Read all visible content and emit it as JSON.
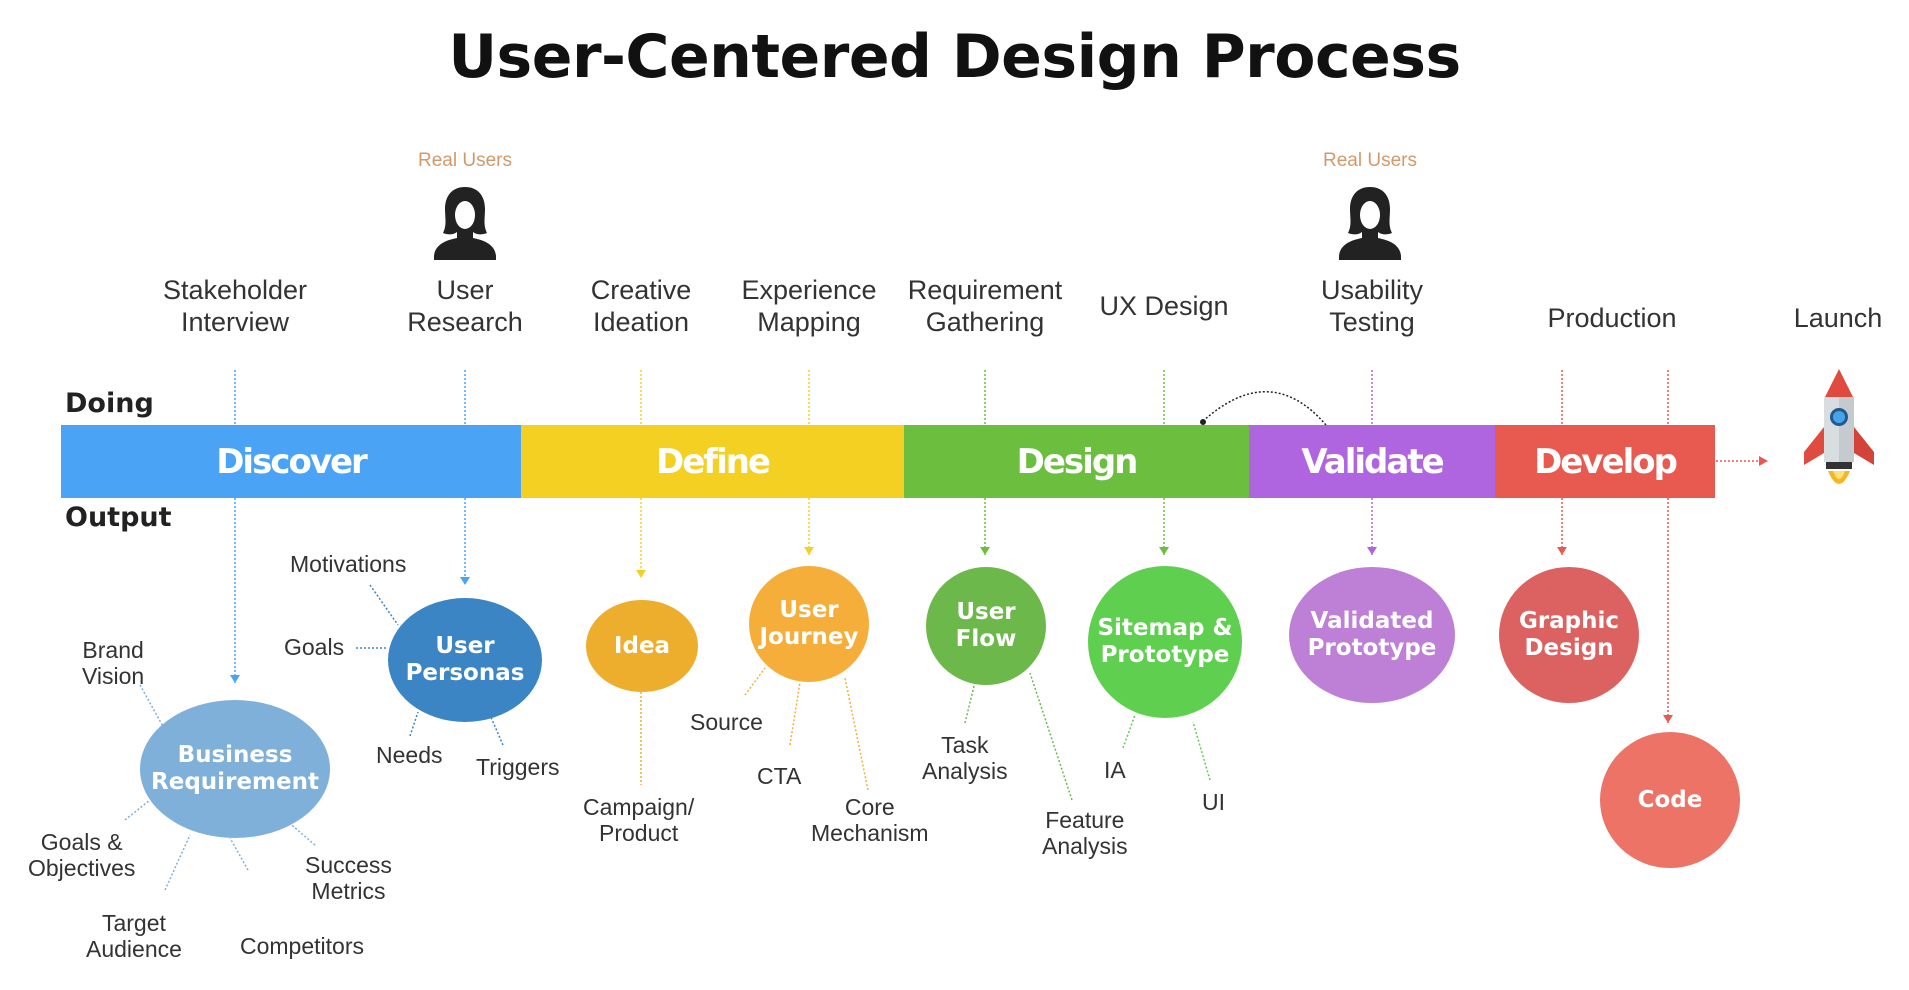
{
  "title": "User-Centered Design Process",
  "row_labels": {
    "doing": "Doing",
    "output": "Output"
  },
  "real_users_label": "Real Users",
  "activities": [
    {
      "label": "Stakeholder\nInterview"
    },
    {
      "label": "User\nResearch",
      "real_users": true
    },
    {
      "label": "Creative\nIdeation"
    },
    {
      "label": "Experience\nMapping"
    },
    {
      "label": "Requirement\nGathering"
    },
    {
      "label": "UX Design"
    },
    {
      "label": "Usability\nTesting",
      "real_users": true
    },
    {
      "label": "Production"
    },
    {
      "label": "Launch"
    }
  ],
  "phases": [
    {
      "label": "Discover",
      "color": "#4aa3f5"
    },
    {
      "label": "Define",
      "color": "#f4d023"
    },
    {
      "label": "Design",
      "color": "#6cbf3e"
    },
    {
      "label": "Validate",
      "color": "#b065e0"
    },
    {
      "label": "Develop",
      "color": "#e8594f"
    }
  ],
  "outputs": [
    {
      "label": "Business\nRequirement",
      "color": "#7fb0da",
      "sub": [
        "Brand\nVision",
        "Goals &\nObjectives",
        "Target\nAudience",
        "Competitors",
        "Success\nMetrics"
      ]
    },
    {
      "label": "User\nPersonas",
      "color": "#3b85c4",
      "sub": [
        "Motivations",
        "Goals",
        "Needs",
        "Triggers"
      ]
    },
    {
      "label": "Idea",
      "color": "#ecae2c",
      "sub": [
        "Campaign/\nProduct"
      ]
    },
    {
      "label": "User\nJourney",
      "color": "#f6ae3b",
      "sub": [
        "Source",
        "CTA",
        "Core\nMechanism"
      ]
    },
    {
      "label": "User\nFlow",
      "color": "#6db84a",
      "sub": [
        "Task\nAnalysis",
        "Feature\nAnalysis"
      ]
    },
    {
      "label": "Sitemap &\nPrototype",
      "color": "#5fcf4f",
      "sub": [
        "IA",
        "UI"
      ]
    },
    {
      "label": "Validated\nPrototype",
      "color": "#be7fd6",
      "sub": []
    },
    {
      "label": "Graphic\nDesign",
      "color": "#db6260",
      "sub": []
    },
    {
      "label": "Code",
      "color": "#ec7366",
      "sub": []
    }
  ],
  "icons": {
    "real_user": "person-icon",
    "launch": "rocket-icon",
    "feedback": "loop-arrow-icon"
  },
  "colors": {
    "real_users_text": "#d29a6a",
    "connector": "#9aa"
  }
}
